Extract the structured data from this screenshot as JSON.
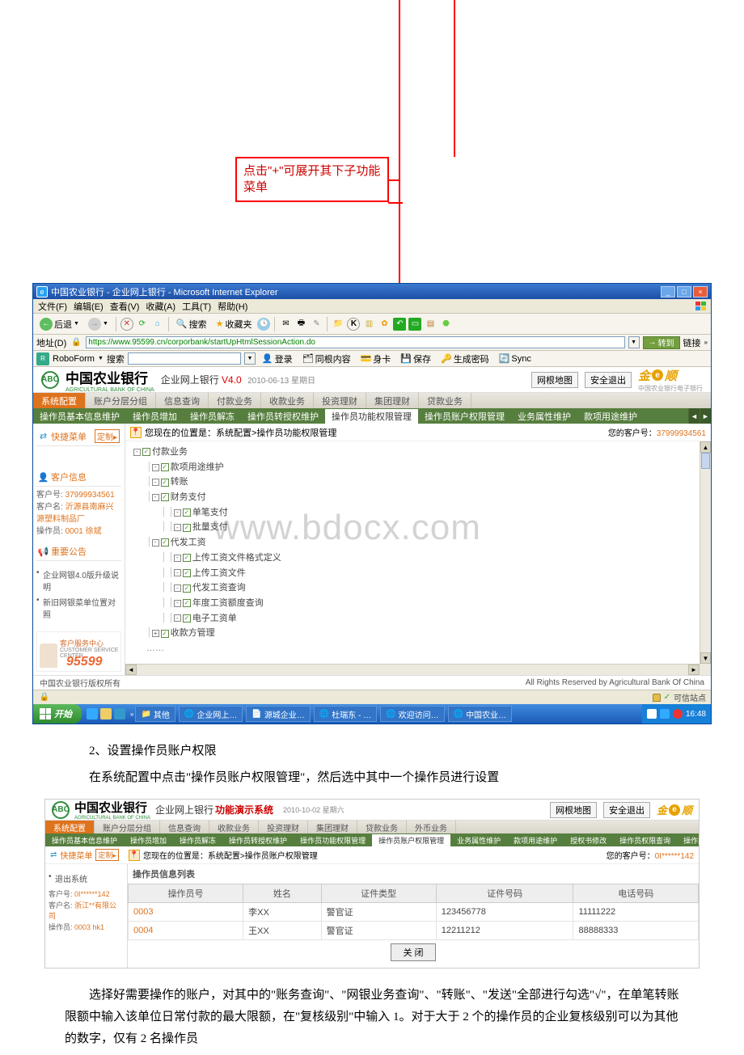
{
  "callout": {
    "text": "点击\"+\"可展开其下子功能菜单"
  },
  "ie": {
    "title": "中国农业银行 - 企业网上银行 - Microsoft Internet Explorer",
    "menu": {
      "file": "文件(F)",
      "edit": "编辑(E)",
      "view": "查看(V)",
      "fav": "收藏(A)",
      "tools": "工具(T)",
      "help": "帮助(H)"
    },
    "toolbar": {
      "back": "后退",
      "search": "搜索",
      "favbtn": "收藏夹"
    },
    "addr": {
      "label": "地址(D)",
      "url": "https://www.95599.cn/corporbank/startUpHtmlSessionAction.do",
      "go": "转到",
      "links": "链接"
    },
    "robo": {
      "brand": "RoboForm",
      "search_label": "搜索",
      "login": "登录",
      "fill": "同根内容",
      "kcard": "身卡",
      "save": "保存",
      "gen": "生成密码",
      "sync": "Sync"
    }
  },
  "bank": {
    "name": "中国农业银行",
    "name_en": "AGRICULTURAL BANK OF CHINA",
    "subtitle": "企业网上银行",
    "version": "V4.0",
    "date": "2010-06-13 星期日",
    "btn_map": "网根地图",
    "btn_exit": "安全退出",
    "jin": "金",
    "shun": "顺",
    "jindesc": "中国农业银行电子银行",
    "maintabs": [
      "系统配置",
      "账户分层分组",
      "信息查询",
      "付款业务",
      "收款业务",
      "投资理财",
      "集团理财",
      "贷款业务"
    ],
    "subtabs": [
      "操作员基本信息维护",
      "操作员增加",
      "操作员解冻",
      "操作员转授权维护",
      "操作员功能权限管理",
      "操作员账户权限管理",
      "业务属性维护",
      "款项用途维护"
    ],
    "quick": "快捷菜单",
    "customize": "定制",
    "custinfo_title": "客户信息",
    "cust": {
      "id_label": "客户号:",
      "id": "37999934561",
      "name_label": "客户名:",
      "name": "沂源县南麻兴源塑料制品厂",
      "op_label": "操作员:",
      "op": "0001 徐斌"
    },
    "notice_title": "重要公告",
    "notices": [
      "企业网银4.0版升级说明",
      "新旧网银菜单位置对照"
    ],
    "svc": {
      "title": "客户服务中心",
      "en": "CUSTOMER SERVICE CENTER",
      "phone": "95599"
    },
    "breadcrumb": "您现在的位置是：系统配置>操作员功能权限管理",
    "cust_id_r": "您的客户号：",
    "cust_id_rv": "37999934561",
    "tree": [
      {
        "lvl": 0,
        "pm": "-",
        "cb": true,
        "label": "付款业务"
      },
      {
        "lvl": 1,
        "pm": "-",
        "cb": true,
        "label": "款项用途维护"
      },
      {
        "lvl": 1,
        "pm": "-",
        "cb": true,
        "label": "转账"
      },
      {
        "lvl": 1,
        "pm": "-",
        "cb": true,
        "label": "财务支付"
      },
      {
        "lvl": 2,
        "pm": "-",
        "cb": true,
        "label": "单笔支付"
      },
      {
        "lvl": 2,
        "pm": "-",
        "cb": true,
        "label": "批量支付"
      },
      {
        "lvl": 1,
        "pm": "-",
        "cb": true,
        "label": "代发工资"
      },
      {
        "lvl": 2,
        "pm": "-",
        "cb": true,
        "label": "上传工资文件格式定义"
      },
      {
        "lvl": 2,
        "pm": "-",
        "cb": true,
        "label": "上传工资文件"
      },
      {
        "lvl": 2,
        "pm": "-",
        "cb": true,
        "label": "代发工资查询"
      },
      {
        "lvl": 2,
        "pm": "-",
        "cb": true,
        "label": "年度工资额度查询"
      },
      {
        "lvl": 2,
        "pm": "-",
        "cb": true,
        "label": "电子工资单"
      },
      {
        "lvl": 1,
        "pm": "+",
        "cb": true,
        "label": "收款方管理"
      }
    ],
    "footer_l": "中国农业银行版权所有",
    "footer_r": "All Rights Reserved by Agricultural Bank Of China",
    "trust": "可信站点"
  },
  "taskbar": {
    "start": "开始",
    "items": [
      "其他",
      "企业网上…",
      "源城企业…",
      "杜瑞东 - …",
      "欢迎访问…",
      "中国农业…"
    ],
    "time": "16:48"
  },
  "para1": "2、设置操作员账户权限",
  "para2": "在系统配置中点击\"操作员账户权限管理\"，然后选中其中一个操作员进行设置",
  "shot2": {
    "subtitle": "企业网上银行",
    "demo": "功能演示系统",
    "date": "2010-10-02 星期六",
    "maintabs": [
      "系统配置",
      "账户分层分组",
      "信息查询",
      "收款业务",
      "投资理财",
      "集团理财",
      "贷款业务",
      "外币业务"
    ],
    "subtabs": [
      "操作员基本信息维护",
      "操作员增加",
      "操作员解冻",
      "操作员转授权维护",
      "操作员功能权限管理",
      "操作员账户权限管理",
      "业务属性维护",
      "款项用途维护",
      "授权书修改",
      "操作员权限查询",
      "操作员历史交易查询"
    ],
    "breadcrumb": "您现在的位置是：系统配置>操作员账户权限管理",
    "cust_id_r": "您的客户号：",
    "cust_id_rv": "0I******142",
    "leftnav": [
      "退出系统"
    ],
    "cust": {
      "id_label": "客户号:",
      "id": "0I******142",
      "name_label": "客户名:",
      "name": "浙江**有限公司",
      "op_label": "操作员:",
      "op": "0003 hk1"
    },
    "table_caption": "操作员信息列表",
    "headers": [
      "操作员号",
      "姓名",
      "证件类型",
      "证件号码",
      "电话号码"
    ],
    "rows": [
      {
        "id": "0003",
        "name": "李XX",
        "type": "警官证",
        "idno": "123456778",
        "phone": "11111222"
      },
      {
        "id": "0004",
        "name": "王XX",
        "type": "警官证",
        "idno": "12211212",
        "phone": "88888333"
      }
    ],
    "btn": "关 闭"
  },
  "para3": "选择好需要操作的账户，对其中的\"账务查询\"、\"网银业务查询\"、\"转账\"、\"发送\"全部进行勾选\"√\"，在单笔转账限额中输入该单位日常付款的最大限额，在\"复核级别\"中输入 1。对于大于 2 个的操作员的企业复核级别可以为其他的数字，仅有 2 名操作员"
}
